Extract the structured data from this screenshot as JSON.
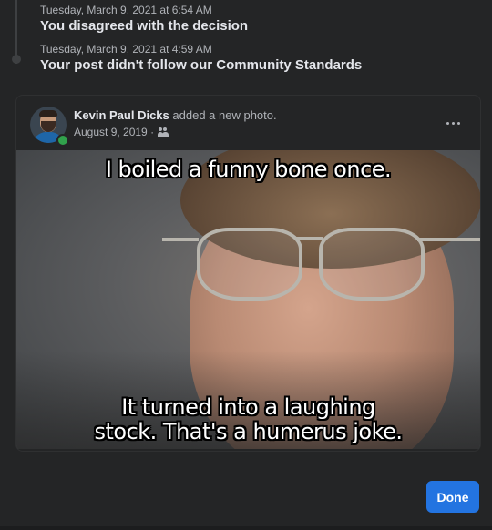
{
  "timeline": {
    "events": [
      {
        "date": "Tuesday, March 9, 2021 at 6:54 AM",
        "title": "You disagreed with the decision"
      },
      {
        "date": "Tuesday, March 9, 2021 at 4:59 AM",
        "title": "Your post didn't follow our Community Standards"
      }
    ]
  },
  "post": {
    "author": "Kevin Paul Dicks",
    "action": "added a new photo.",
    "date": "August 9, 2019 ·",
    "audience_icon": "friends-icon",
    "more_icon": "more-horizontal-icon",
    "photo": {
      "caption_top": "I boiled a funny bone once.",
      "caption_bottom_line1": "It turned into a laughing",
      "caption_bottom_line2": "stock. That's a humerus joke."
    }
  },
  "footer": {
    "done_label": "Done"
  },
  "colors": {
    "background": "#242526",
    "accent": "#2374e1",
    "online": "#31a24c"
  }
}
